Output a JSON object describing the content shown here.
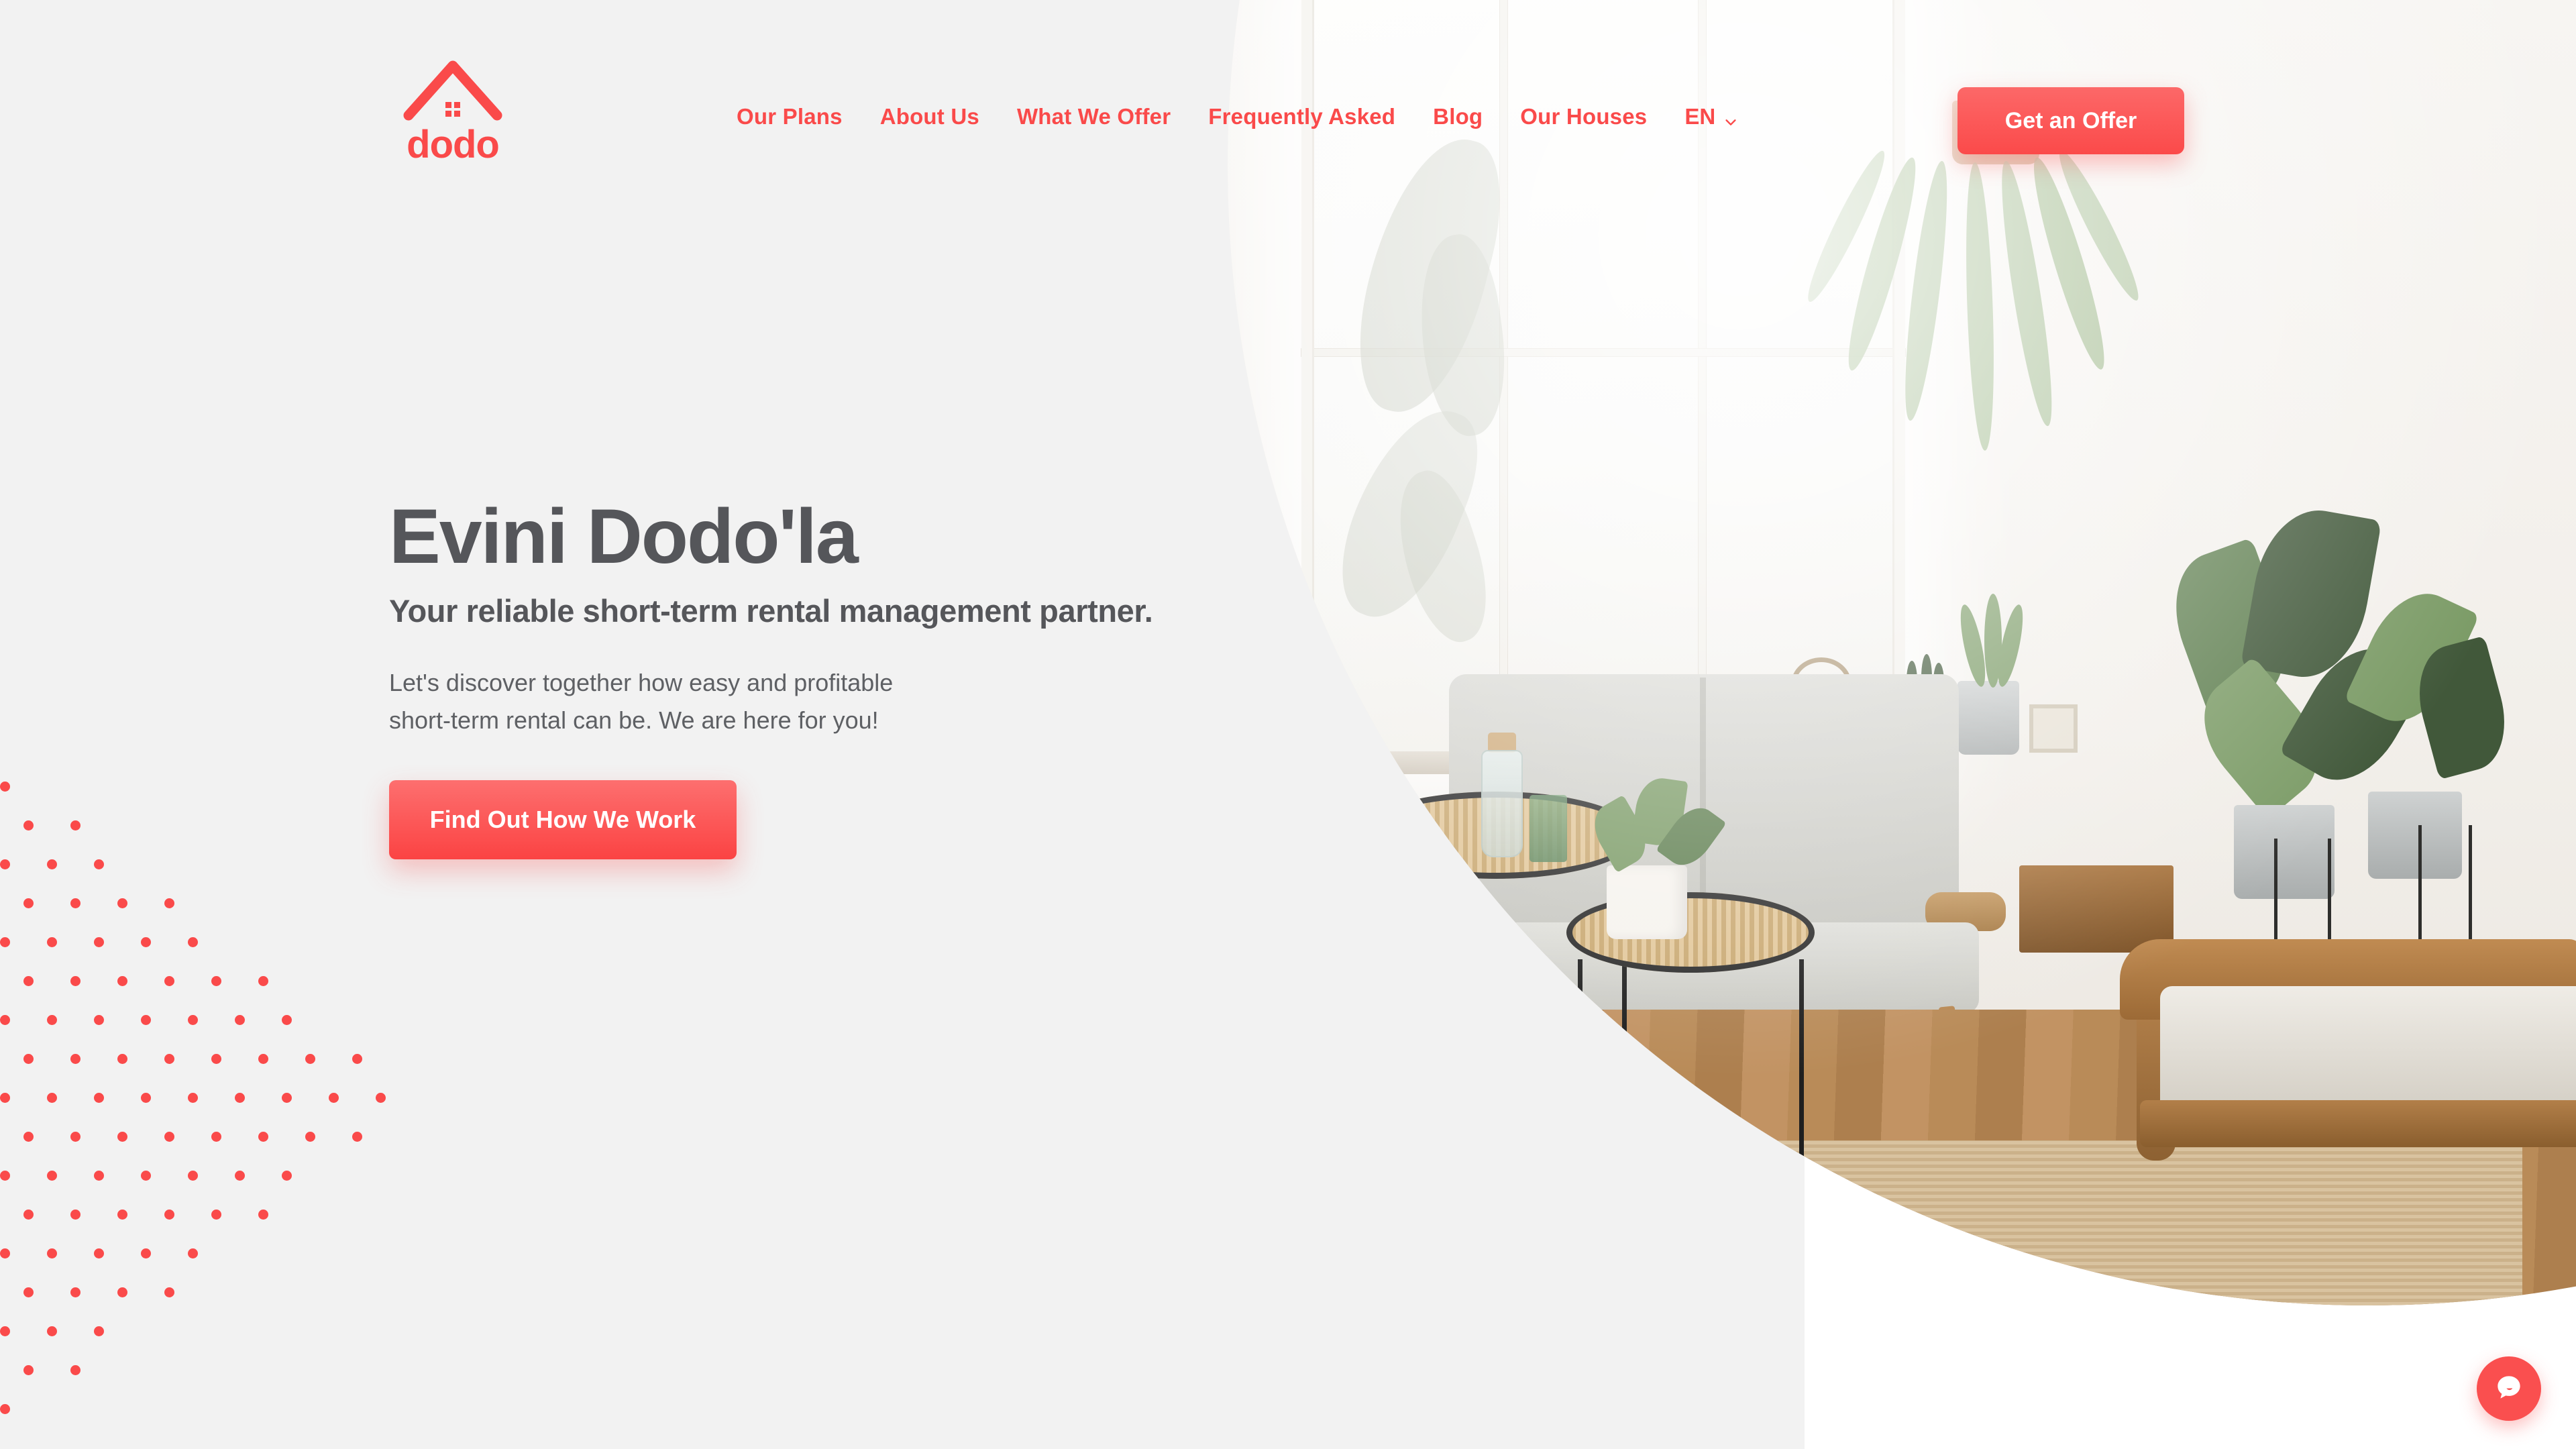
{
  "brand": {
    "name": "dodo",
    "accent_color": "#fa4a4a",
    "logo_icon": "house-chevron-icon"
  },
  "nav": {
    "items": [
      {
        "label": "Our Plans"
      },
      {
        "label": "About Us"
      },
      {
        "label": "What We Offer"
      },
      {
        "label": "Frequently Asked"
      },
      {
        "label": "Blog"
      },
      {
        "label": "Our Houses"
      }
    ],
    "language": {
      "selected": "EN",
      "icon": "chevron-down-icon"
    },
    "cta": {
      "label": "Get an Offer"
    }
  },
  "hero": {
    "title": "Evini Dodo'la",
    "subtitle": "Your reliable short-term rental management partner.",
    "body": "Let's discover together how easy and profitable short-term rental can be. We are here for you!",
    "cta": {
      "label": "Find Out How We Work"
    }
  },
  "decor": {
    "dot_pattern_color": "#fa4a4a"
  },
  "chat_widget": {
    "icon": "chat-bubble-icon",
    "color": "#fa4f4f"
  }
}
